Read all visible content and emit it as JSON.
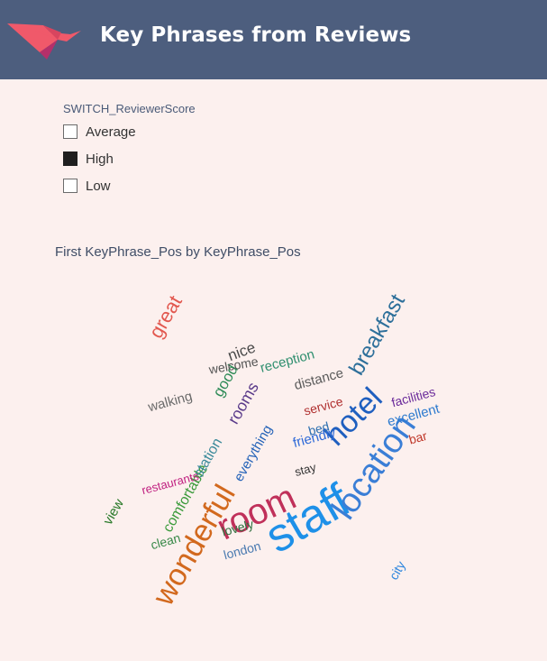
{
  "header": {
    "title": "Key Phrases from Reviews"
  },
  "slicer": {
    "title": "SWITCH_ReviewerScore",
    "options": [
      {
        "label": "Average",
        "checked": false
      },
      {
        "label": "High",
        "checked": true
      },
      {
        "label": "Low",
        "checked": false
      }
    ]
  },
  "wordcloud": {
    "title": "First KeyPhrase_Pos by KeyPhrase_Pos",
    "words": [
      "staff",
      "room",
      "location",
      "wonderful",
      "hotel",
      "breakfast",
      "great",
      "rooms",
      "good",
      "nice",
      "walking",
      "distance",
      "friendly",
      "excellent",
      "reception",
      "welcome",
      "comfortable",
      "station",
      "everything",
      "view",
      "restaurants",
      "lovely",
      "london",
      "service",
      "facilities",
      "clean",
      "bar",
      "city",
      "stay",
      "bed"
    ]
  }
}
